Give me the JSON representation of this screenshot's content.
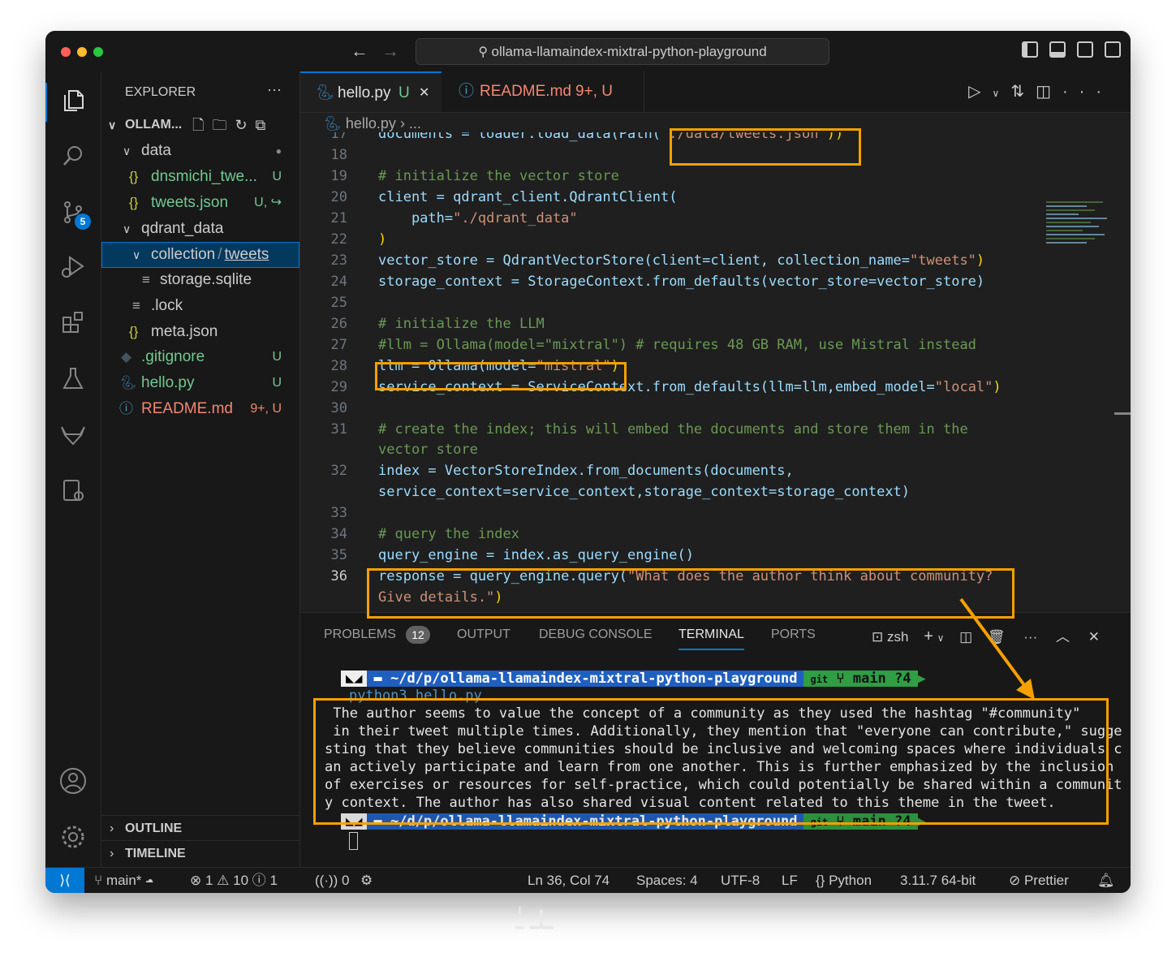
{
  "window": {
    "search": "ollama-llamaindex-mixtral-python-playground"
  },
  "activity_badge": "5",
  "sidebar": {
    "title": "EXPLORER",
    "more": "···",
    "root": "OLLAM...",
    "tree": [
      {
        "label": "data",
        "status": "●"
      },
      {
        "label": "dnsmichi_twe...",
        "status": "U"
      },
      {
        "label": "tweets.json",
        "status": "U, ↪"
      },
      {
        "label": "qdrant_data",
        "status": ""
      },
      {
        "label_a": "collection",
        "sep": "/",
        "label_b": "tweets"
      },
      {
        "label": "storage.sqlite",
        "status": ""
      },
      {
        "label": ".lock",
        "status": ""
      },
      {
        "label": "meta.json",
        "status": ""
      },
      {
        "label": ".gitignore",
        "status": "U"
      },
      {
        "label": "hello.py",
        "status": "U"
      },
      {
        "label": "README.md",
        "status": "9+, U"
      }
    ],
    "outline": "OUTLINE",
    "timeline": "TIMELINE"
  },
  "tabs": [
    {
      "label": "hello.py",
      "status": "U",
      "close": "✕"
    },
    {
      "label": "README.md",
      "status": "9+, U"
    }
  ],
  "breadcrumb": {
    "file": "hello.py",
    "rest": "› ..."
  },
  "code": {
    "line_numbers": [
      "17",
      "18",
      "19",
      "20",
      "21",
      "22",
      "23",
      "24",
      "25",
      "26",
      "27",
      "28",
      "29",
      "30",
      "31",
      "",
      "32",
      "",
      "33",
      "34",
      "35",
      "36",
      ""
    ],
    "l17_a": "documents = loader.load_data(Path(",
    "l17_b": "'./data/tweets.json'",
    "l17_c": "))",
    "l19": "# initialize the vector store",
    "l20": "client = qdrant_client.QdrantClient(",
    "l21_a": "    path=",
    "l21_b": "\"./qdrant_data\"",
    "l22": ")",
    "l23_a": "vector_store = QdrantVectorStore(client=client, collection_name=",
    "l23_b": "\"tweets\"",
    "l23_c": ")",
    "l24": "storage_context = StorageContext.from_defaults(vector_store=vector_store)",
    "l26": "# initialize the LLM",
    "l27": "#llm = Ollama(model=\"mixtral\") # requires 48 GB RAM, use Mistral instead",
    "l28_a": "llm = Ollama(model=",
    "l28_b": "\"mistral\"",
    "l28_c": ")",
    "l29_a": "service_context = ServiceContext.from_defaults(llm=llm,embed_model=",
    "l29_b": "\"local\"",
    "l29_c": ")",
    "l31a": "# create the index; this will embed the documents and store them in the",
    "l31b": "vector store",
    "l32a": "index = VectorStoreIndex.from_documents(documents,",
    "l32b": "service_context=service_context,storage_context=storage_context)",
    "l34": "# query the index",
    "l35": "query_engine = index.as_query_engine()",
    "l36a_a": "response = query_engine.query(",
    "l36a_b": "\"What does the author think about community?",
    "l36b_a": "Give details.\"",
    "l36b_b": ")"
  },
  "panel": {
    "tabs": [
      "PROBLEMS",
      "OUTPUT",
      "DEBUG CONSOLE",
      "TERMINAL",
      "PORTS"
    ],
    "problems_count": "12",
    "shell": "zsh",
    "prompt_path": "~/d/p/ollama-llamaindex-mixtral-python-playground",
    "prompt_git": "git",
    "prompt_branch": "main ?4",
    "command": "python3 hello.py",
    "output": [
      " The author seems to value the concept of a community as they used the hashtag \"#community\"",
      " in their tweet multiple times. Additionally, they mention that \"everyone can contribute,\" sugge",
      "sting that they believe communities should be inclusive and welcoming spaces where individuals c",
      "an actively participate and learn from one another. This is further emphasized by the inclusion",
      "of exercises or resources for self-practice, which could potentially be shared within a communit",
      "y context. The author has also shared visual content related to this theme in the tweet."
    ]
  },
  "statusbar": {
    "branch": "main*",
    "errors": "1",
    "warnings": "10",
    "infos": "1",
    "ports": "0",
    "position": "Ln 36, Col 74",
    "spaces": "Spaces: 4",
    "encoding": "UTF-8",
    "eol": "LF",
    "language": "Python",
    "interpreter": "3.11.7 64-bit",
    "formatter": "Prettier"
  },
  "colors": {
    "accent": "#0078d4",
    "highlight": "#f5a000",
    "modified": "#e2c08d",
    "readme": "#f48771"
  }
}
